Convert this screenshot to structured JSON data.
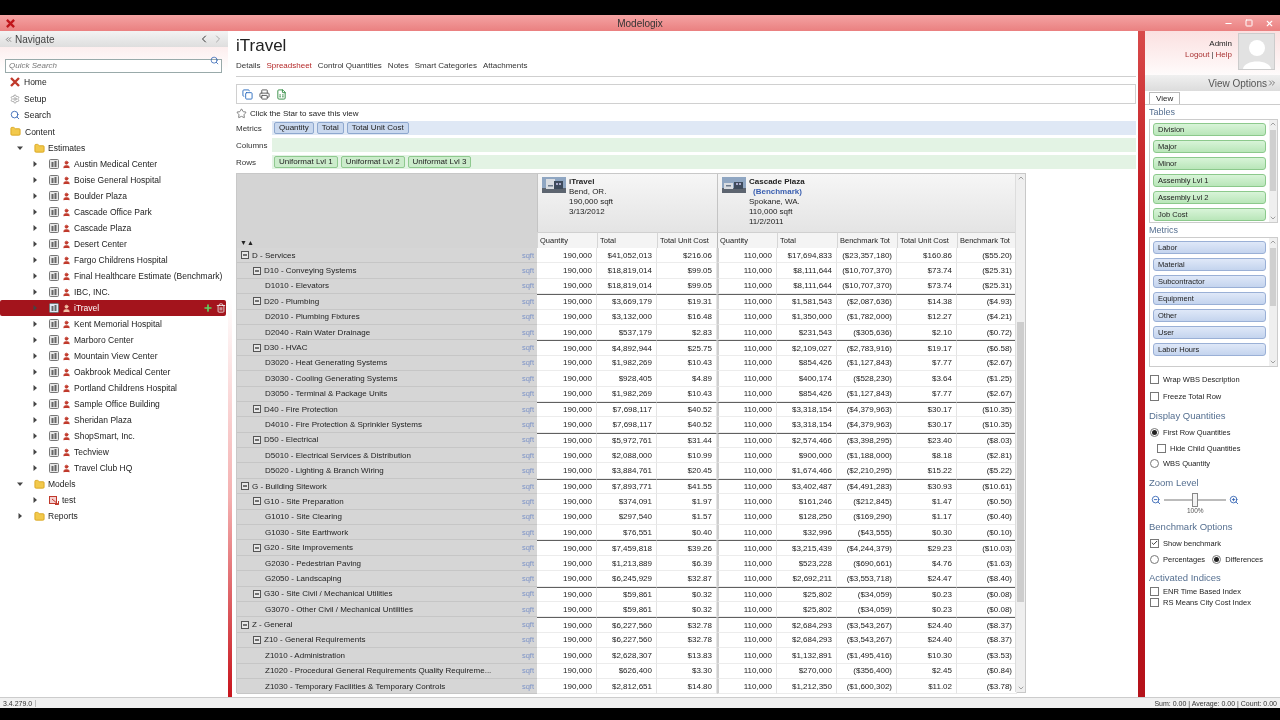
{
  "window": {
    "title": "Modelogix"
  },
  "navigate": {
    "title": "Navigate",
    "search": {
      "placeholder": "Quick Search"
    },
    "links": [
      {
        "label": "Home"
      },
      {
        "label": "Setup"
      },
      {
        "label": "Search"
      },
      {
        "label": "Content"
      }
    ],
    "tree": [
      {
        "label": "Estimates",
        "kind": "folder",
        "expanded": true,
        "selected": false,
        "children": [
          {
            "label": "Austin Medical Center",
            "kind": "estimate",
            "expanded": false,
            "selected": false
          },
          {
            "label": "Boise General Hospital",
            "kind": "estimate",
            "expanded": false,
            "selected": false
          },
          {
            "label": "Boulder Plaza",
            "kind": "estimate",
            "expanded": false,
            "selected": false
          },
          {
            "label": "Cascade Office Park",
            "kind": "estimate",
            "expanded": false,
            "selected": false
          },
          {
            "label": "Cascade Plaza",
            "kind": "estimate",
            "expanded": false,
            "selected": false
          },
          {
            "label": "Desert Center",
            "kind": "estimate",
            "expanded": false,
            "selected": false
          },
          {
            "label": "Fargo Childrens Hospital",
            "kind": "estimate",
            "expanded": false,
            "selected": false
          },
          {
            "label": "Final Healthcare Estimate (Benchmark)",
            "kind": "estimate",
            "expanded": false,
            "selected": false
          },
          {
            "label": "IBC, INC.",
            "kind": "estimate",
            "expanded": false,
            "selected": false
          },
          {
            "label": "iTravel",
            "kind": "estimate",
            "expanded": false,
            "selected": true
          },
          {
            "label": "Kent Memorial Hospital",
            "kind": "estimate",
            "expanded": false,
            "selected": false
          },
          {
            "label": "Marboro Center",
            "kind": "estimate",
            "expanded": false,
            "selected": false
          },
          {
            "label": "Mountain View Center",
            "kind": "estimate",
            "expanded": false,
            "selected": false
          },
          {
            "label": "Oakbrook Medical Center",
            "kind": "estimate",
            "expanded": false,
            "selected": false
          },
          {
            "label": "Portland Childrens Hospital",
            "kind": "estimate",
            "expanded": false,
            "selected": false
          },
          {
            "label": "Sample Office Building",
            "kind": "estimate",
            "expanded": false,
            "selected": false
          },
          {
            "label": "Sheridan Plaza",
            "kind": "estimate",
            "expanded": false,
            "selected": false
          },
          {
            "label": "ShopSmart, Inc.",
            "kind": "estimate",
            "expanded": false,
            "selected": false
          },
          {
            "label": "Techview",
            "kind": "estimate",
            "expanded": false,
            "selected": false
          },
          {
            "label": "Travel Club HQ",
            "kind": "estimate",
            "expanded": false,
            "selected": false
          }
        ]
      },
      {
        "label": "Models",
        "kind": "folder",
        "expanded": true,
        "selected": false,
        "children": [
          {
            "label": "test",
            "kind": "model",
            "expanded": false,
            "selected": false
          }
        ]
      },
      {
        "label": "Reports",
        "kind": "folder",
        "expanded": false,
        "selected": false
      }
    ]
  },
  "page": {
    "title": "iTravel",
    "tabs": [
      {
        "label": "Details",
        "selected": false
      },
      {
        "label": "Spreadsheet",
        "selected": true
      },
      {
        "label": "Control Quantities",
        "selected": false
      },
      {
        "label": "Notes",
        "selected": false
      },
      {
        "label": "Smart Categories",
        "selected": false
      },
      {
        "label": "Attachments",
        "selected": false
      }
    ]
  },
  "user": {
    "name": "Admin",
    "links": [
      {
        "label": "Logout"
      },
      {
        "label": "Help"
      }
    ],
    "separator": "|"
  },
  "spreadsheet": {
    "star_hint": "Click the Star to save this view",
    "metrics": {
      "label": "Metrics",
      "chips": [
        "Quantity",
        "Total",
        "Total Unit Cost"
      ]
    },
    "columns": {
      "label": "Columns"
    },
    "rows_bar": {
      "label": "Rows",
      "chips": [
        "Uniformat Lvl 1",
        "Uniformat Lvl 2",
        "Uniformat Lvl 3"
      ]
    },
    "sort_toggle": "▼▲",
    "projects": [
      {
        "name": "iTravel",
        "location": "Bend, OR.",
        "area": "190,000 sqft",
        "date": "3/13/2012",
        "columns": [
          "Quantity",
          "Total",
          "Total Unit Cost"
        ]
      },
      {
        "name": "Cascade Plaza",
        "tag": "(Benchmark)",
        "location": "Spokane, WA.",
        "area": "110,000 sqft",
        "date": "11/2/2011",
        "columns": [
          "Quantity",
          "Total",
          "Benchmark Tot",
          "Total Unit Cost",
          "Benchmark Tot"
        ]
      }
    ],
    "rows": [
      {
        "label": "D - Services",
        "unit": "sqft",
        "expanded": true,
        "values": [
          "190,000",
          "$41,052,013",
          "$216.06",
          "110,000",
          "$17,694,833",
          "($23,357,180)",
          "$160.86",
          "($55.20)"
        ],
        "children": [
          {
            "label": "D10 - Conveying Systems",
            "unit": "sqft",
            "expanded": true,
            "values": [
              "190,000",
              "$18,819,014",
              "$99.05",
              "110,000",
              "$8,111,644",
              "($10,707,370)",
              "$73.74",
              "($25.31)"
            ],
            "children": [
              {
                "label": "D1010 - Elevators",
                "unit": "sqft",
                "values": [
                  "190,000",
                  "$18,819,014",
                  "$99.05",
                  "110,000",
                  "$8,111,644",
                  "($10,707,370)",
                  "$73.74",
                  "($25.31)"
                ]
              }
            ]
          },
          {
            "label": "D20 - Plumbing",
            "unit": "sqft",
            "expanded": true,
            "values": [
              "190,000",
              "$3,669,179",
              "$19.31",
              "110,000",
              "$1,581,543",
              "($2,087,636)",
              "$14.38",
              "($4.93)"
            ],
            "children": [
              {
                "label": "D2010 - Plumbing Fixtures",
                "unit": "sqft",
                "values": [
                  "190,000",
                  "$3,132,000",
                  "$16.48",
                  "110,000",
                  "$1,350,000",
                  "($1,782,000)",
                  "$12.27",
                  "($4.21)"
                ]
              },
              {
                "label": "D2040 - Rain Water Drainage",
                "unit": "sqft",
                "values": [
                  "190,000",
                  "$537,179",
                  "$2.83",
                  "110,000",
                  "$231,543",
                  "($305,636)",
                  "$2.10",
                  "($0.72)"
                ]
              }
            ]
          },
          {
            "label": "D30 - HVAC",
            "unit": "sqft",
            "expanded": true,
            "values": [
              "190,000",
              "$4,892,944",
              "$25.75",
              "110,000",
              "$2,109,027",
              "($2,783,916)",
              "$19.17",
              "($6.58)"
            ],
            "children": [
              {
                "label": "D3020 - Heat Generating Systems",
                "unit": "sqft",
                "values": [
                  "190,000",
                  "$1,982,269",
                  "$10.43",
                  "110,000",
                  "$854,426",
                  "($1,127,843)",
                  "$7.77",
                  "($2.67)"
                ]
              },
              {
                "label": "D3030 - Cooling Generating Systems",
                "unit": "sqft",
                "values": [
                  "190,000",
                  "$928,405",
                  "$4.89",
                  "110,000",
                  "$400,174",
                  "($528,230)",
                  "$3.64",
                  "($1.25)"
                ]
              },
              {
                "label": "D3050 - Terminal & Package Units",
                "unit": "sqft",
                "values": [
                  "190,000",
                  "$1,982,269",
                  "$10.43",
                  "110,000",
                  "$854,426",
                  "($1,127,843)",
                  "$7.77",
                  "($2.67)"
                ]
              }
            ]
          },
          {
            "label": "D40 - Fire Protection",
            "unit": "sqft",
            "expanded": true,
            "values": [
              "190,000",
              "$7,698,117",
              "$40.52",
              "110,000",
              "$3,318,154",
              "($4,379,963)",
              "$30.17",
              "($10.35)"
            ],
            "children": [
              {
                "label": "D4010 - Fire Protection & Sprinkler Systems",
                "unit": "sqft",
                "values": [
                  "190,000",
                  "$7,698,117",
                  "$40.52",
                  "110,000",
                  "$3,318,154",
                  "($4,379,963)",
                  "$30.17",
                  "($10.35)"
                ]
              }
            ]
          },
          {
            "label": "D50 - Electrical",
            "unit": "sqft",
            "expanded": true,
            "values": [
              "190,000",
              "$5,972,761",
              "$31.44",
              "110,000",
              "$2,574,466",
              "($3,398,295)",
              "$23.40",
              "($8.03)"
            ],
            "children": [
              {
                "label": "D5010 - Electrical Services & Distribution",
                "unit": "sqft",
                "values": [
                  "190,000",
                  "$2,088,000",
                  "$10.99",
                  "110,000",
                  "$900,000",
                  "($1,188,000)",
                  "$8.18",
                  "($2.81)"
                ]
              },
              {
                "label": "D5020 - Lighting & Branch Wiring",
                "unit": "sqft",
                "values": [
                  "190,000",
                  "$3,884,761",
                  "$20.45",
                  "110,000",
                  "$1,674,466",
                  "($2,210,295)",
                  "$15.22",
                  "($5.22)"
                ]
              }
            ]
          }
        ]
      },
      {
        "label": "G - Building Sitework",
        "unit": "sqft",
        "expanded": true,
        "values": [
          "190,000",
          "$7,893,771",
          "$41.55",
          "110,000",
          "$3,402,487",
          "($4,491,283)",
          "$30.93",
          "($10.61)"
        ],
        "children": [
          {
            "label": "G10 - Site Preparation",
            "unit": "sqft",
            "expanded": true,
            "values": [
              "190,000",
              "$374,091",
              "$1.97",
              "110,000",
              "$161,246",
              "($212,845)",
              "$1.47",
              "($0.50)"
            ],
            "children": [
              {
                "label": "G1010 - Site Clearing",
                "unit": "sqft",
                "values": [
                  "190,000",
                  "$297,540",
                  "$1.57",
                  "110,000",
                  "$128,250",
                  "($169,290)",
                  "$1.17",
                  "($0.40)"
                ]
              },
              {
                "label": "G1030 - Site Earthwork",
                "unit": "sqft",
                "values": [
                  "190,000",
                  "$76,551",
                  "$0.40",
                  "110,000",
                  "$32,996",
                  "($43,555)",
                  "$0.30",
                  "($0.10)"
                ]
              }
            ]
          },
          {
            "label": "G20 - Site Improvements",
            "unit": "sqft",
            "expanded": true,
            "values": [
              "190,000",
              "$7,459,818",
              "$39.26",
              "110,000",
              "$3,215,439",
              "($4,244,379)",
              "$29.23",
              "($10.03)"
            ],
            "children": [
              {
                "label": "G2030 - Pedestrian Paving",
                "unit": "sqft",
                "values": [
                  "190,000",
                  "$1,213,889",
                  "$6.39",
                  "110,000",
                  "$523,228",
                  "($690,661)",
                  "$4.76",
                  "($1.63)"
                ]
              },
              {
                "label": "G2050 - Landscaping",
                "unit": "sqft",
                "values": [
                  "190,000",
                  "$6,245,929",
                  "$32.87",
                  "110,000",
                  "$2,692,211",
                  "($3,553,718)",
                  "$24.47",
                  "($8.40)"
                ]
              }
            ]
          },
          {
            "label": "G30 - Site Civil / Mechanical Utilities",
            "unit": "sqft",
            "expanded": true,
            "values": [
              "190,000",
              "$59,861",
              "$0.32",
              "110,000",
              "$25,802",
              "($34,059)",
              "$0.23",
              "($0.08)"
            ],
            "children": [
              {
                "label": "G3070 - Other Civil / Mechanical Untilities",
                "unit": "sqft",
                "values": [
                  "190,000",
                  "$59,861",
                  "$0.32",
                  "110,000",
                  "$25,802",
                  "($34,059)",
                  "$0.23",
                  "($0.08)"
                ]
              }
            ]
          }
        ]
      },
      {
        "label": "Z - General",
        "unit": "sqft",
        "expanded": true,
        "values": [
          "190,000",
          "$6,227,560",
          "$32.78",
          "110,000",
          "$2,684,293",
          "($3,543,267)",
          "$24.40",
          "($8.37)"
        ],
        "children": [
          {
            "label": "Z10 - General Requirements",
            "unit": "sqft",
            "expanded": true,
            "values": [
              "190,000",
              "$6,227,560",
              "$32.78",
              "110,000",
              "$2,684,293",
              "($3,543,267)",
              "$24.40",
              "($8.37)"
            ],
            "children": [
              {
                "label": "Z1010 - Administration",
                "unit": "sqft",
                "values": [
                  "190,000",
                  "$2,628,307",
                  "$13.83",
                  "110,000",
                  "$1,132,891",
                  "($1,495,416)",
                  "$10.30",
                  "($3.53)"
                ]
              },
              {
                "label": "Z1020 - Procedural General Requirements Quality Requireme...",
                "unit": "sqft",
                "values": [
                  "190,000",
                  "$626,400",
                  "$3.30",
                  "110,000",
                  "$270,000",
                  "($356,400)",
                  "$2.45",
                  "($0.84)"
                ]
              },
              {
                "label": "Z1030 - Temporary Facilities & Temporary Controls",
                "unit": "sqft",
                "values": [
                  "190,000",
                  "$2,812,651",
                  "$14.80",
                  "110,000",
                  "$1,212,350",
                  "($1,600,302)",
                  "$11.02",
                  "($3.78)"
                ]
              }
            ]
          }
        ]
      }
    ]
  },
  "view_options": {
    "title": "View Options",
    "tabs": [
      {
        "label": "View",
        "selected": true
      }
    ],
    "tables": {
      "label": "Tables",
      "items": [
        "Division",
        "Major",
        "Minor",
        "Assembly Lvl 1",
        "Assembly Lvl 2",
        "Job Cost"
      ]
    },
    "metrics": {
      "label": "Metrics",
      "items": [
        "Labor",
        "Material",
        "Subcontractor",
        "Equipment",
        "Other",
        "User",
        "Labor Hours"
      ]
    },
    "toggles": [
      {
        "label": "Wrap WBS Description",
        "checked": false
      },
      {
        "label": "Freeze Total Row",
        "checked": false
      }
    ],
    "display_quantities": {
      "label": "Display Quantities",
      "options": [
        {
          "kind": "radio",
          "label": "First Row Quantities",
          "selected": true
        },
        {
          "kind": "checkbox",
          "label": "Hide Child Quantities",
          "checked": false
        },
        {
          "kind": "radio",
          "label": "WBS Quantity",
          "selected": false
        }
      ]
    },
    "zoom": {
      "label": "Zoom Level",
      "level": 0.5,
      "reading": "100%"
    },
    "benchmark": {
      "label": "Benchmark Options",
      "show": {
        "label": "Show benchmark",
        "checked": true
      },
      "modes": [
        {
          "label": "Percentages",
          "selected": false
        },
        {
          "label": "Differences",
          "selected": true
        }
      ]
    },
    "indices": {
      "label": "Activated Indices",
      "items": [
        {
          "label": "ENR Time Based Index",
          "checked": false
        },
        {
          "label": "RS Means City Cost Index",
          "checked": false
        }
      ]
    }
  },
  "status_bar": {
    "version": "3.4.279.0",
    "summary": "Sum: 0.00 | Average: 0.00 | Count: 0.00"
  }
}
